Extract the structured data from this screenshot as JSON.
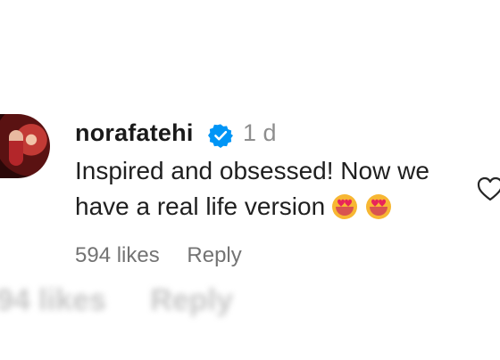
{
  "comment": {
    "username": "norafatehi",
    "time": "1 d",
    "text_line1": "Inspired and obsessed! Now we",
    "text_line2": "have a real life version",
    "likes": "594 likes",
    "reply_label": "Reply",
    "emoji": "heart-eyes-emoji"
  },
  "next_comment": {
    "likes_partial": "94 likes",
    "reply_label": "Reply"
  },
  "colors": {
    "verified_badge": "#0095f6",
    "username": "#1a1a1a",
    "secondary_text": "#737373"
  }
}
